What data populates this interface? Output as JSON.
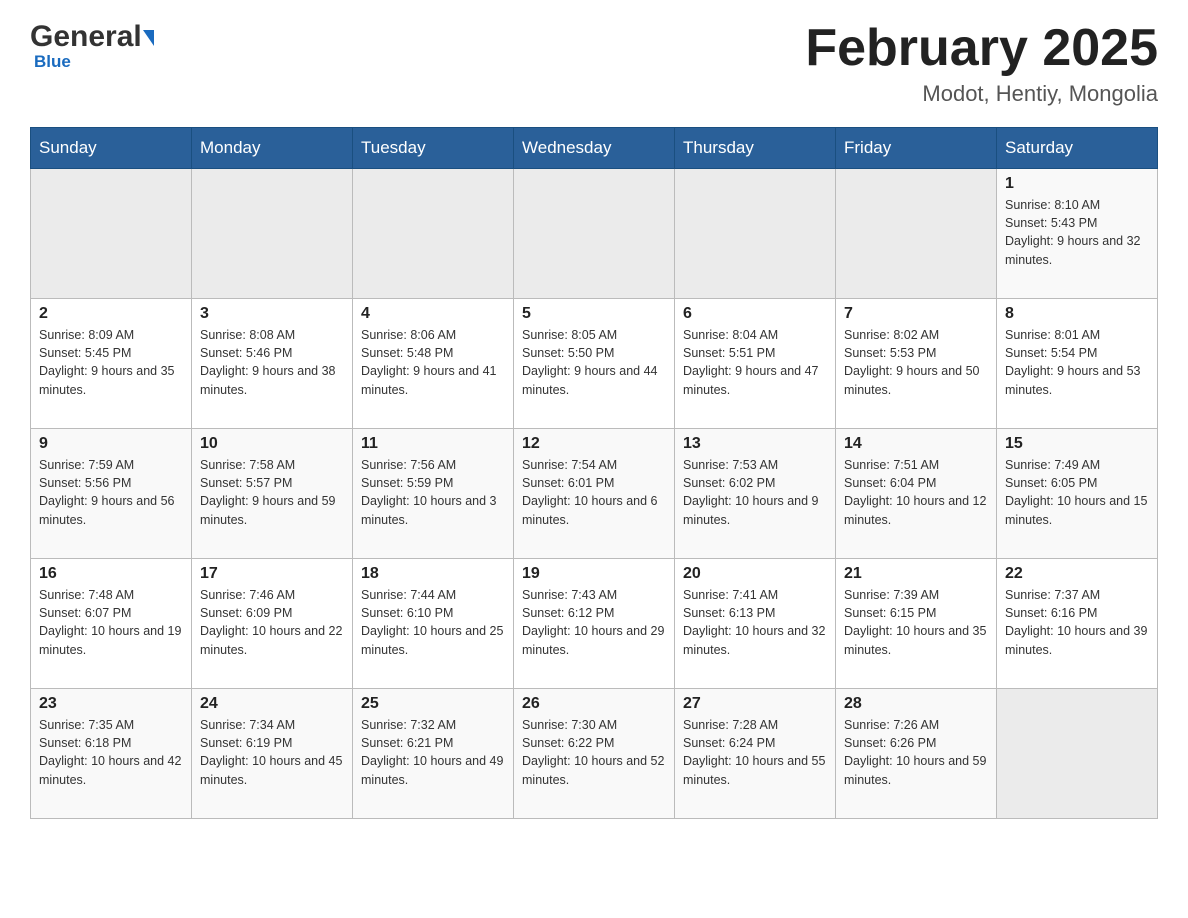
{
  "logo": {
    "brand": "General",
    "accent": "Blue",
    "color": "#1a6bbf"
  },
  "header": {
    "title": "February 2025",
    "subtitle": "Modot, Hentiy, Mongolia"
  },
  "weekdays": [
    "Sunday",
    "Monday",
    "Tuesday",
    "Wednesday",
    "Thursday",
    "Friday",
    "Saturday"
  ],
  "weeks": [
    [
      {
        "day": "",
        "info": ""
      },
      {
        "day": "",
        "info": ""
      },
      {
        "day": "",
        "info": ""
      },
      {
        "day": "",
        "info": ""
      },
      {
        "day": "",
        "info": ""
      },
      {
        "day": "",
        "info": ""
      },
      {
        "day": "1",
        "info": "Sunrise: 8:10 AM\nSunset: 5:43 PM\nDaylight: 9 hours and 32 minutes."
      }
    ],
    [
      {
        "day": "2",
        "info": "Sunrise: 8:09 AM\nSunset: 5:45 PM\nDaylight: 9 hours and 35 minutes."
      },
      {
        "day": "3",
        "info": "Sunrise: 8:08 AM\nSunset: 5:46 PM\nDaylight: 9 hours and 38 minutes."
      },
      {
        "day": "4",
        "info": "Sunrise: 8:06 AM\nSunset: 5:48 PM\nDaylight: 9 hours and 41 minutes."
      },
      {
        "day": "5",
        "info": "Sunrise: 8:05 AM\nSunset: 5:50 PM\nDaylight: 9 hours and 44 minutes."
      },
      {
        "day": "6",
        "info": "Sunrise: 8:04 AM\nSunset: 5:51 PM\nDaylight: 9 hours and 47 minutes."
      },
      {
        "day": "7",
        "info": "Sunrise: 8:02 AM\nSunset: 5:53 PM\nDaylight: 9 hours and 50 minutes."
      },
      {
        "day": "8",
        "info": "Sunrise: 8:01 AM\nSunset: 5:54 PM\nDaylight: 9 hours and 53 minutes."
      }
    ],
    [
      {
        "day": "9",
        "info": "Sunrise: 7:59 AM\nSunset: 5:56 PM\nDaylight: 9 hours and 56 minutes."
      },
      {
        "day": "10",
        "info": "Sunrise: 7:58 AM\nSunset: 5:57 PM\nDaylight: 9 hours and 59 minutes."
      },
      {
        "day": "11",
        "info": "Sunrise: 7:56 AM\nSunset: 5:59 PM\nDaylight: 10 hours and 3 minutes."
      },
      {
        "day": "12",
        "info": "Sunrise: 7:54 AM\nSunset: 6:01 PM\nDaylight: 10 hours and 6 minutes."
      },
      {
        "day": "13",
        "info": "Sunrise: 7:53 AM\nSunset: 6:02 PM\nDaylight: 10 hours and 9 minutes."
      },
      {
        "day": "14",
        "info": "Sunrise: 7:51 AM\nSunset: 6:04 PM\nDaylight: 10 hours and 12 minutes."
      },
      {
        "day": "15",
        "info": "Sunrise: 7:49 AM\nSunset: 6:05 PM\nDaylight: 10 hours and 15 minutes."
      }
    ],
    [
      {
        "day": "16",
        "info": "Sunrise: 7:48 AM\nSunset: 6:07 PM\nDaylight: 10 hours and 19 minutes."
      },
      {
        "day": "17",
        "info": "Sunrise: 7:46 AM\nSunset: 6:09 PM\nDaylight: 10 hours and 22 minutes."
      },
      {
        "day": "18",
        "info": "Sunrise: 7:44 AM\nSunset: 6:10 PM\nDaylight: 10 hours and 25 minutes."
      },
      {
        "day": "19",
        "info": "Sunrise: 7:43 AM\nSunset: 6:12 PM\nDaylight: 10 hours and 29 minutes."
      },
      {
        "day": "20",
        "info": "Sunrise: 7:41 AM\nSunset: 6:13 PM\nDaylight: 10 hours and 32 minutes."
      },
      {
        "day": "21",
        "info": "Sunrise: 7:39 AM\nSunset: 6:15 PM\nDaylight: 10 hours and 35 minutes."
      },
      {
        "day": "22",
        "info": "Sunrise: 7:37 AM\nSunset: 6:16 PM\nDaylight: 10 hours and 39 minutes."
      }
    ],
    [
      {
        "day": "23",
        "info": "Sunrise: 7:35 AM\nSunset: 6:18 PM\nDaylight: 10 hours and 42 minutes."
      },
      {
        "day": "24",
        "info": "Sunrise: 7:34 AM\nSunset: 6:19 PM\nDaylight: 10 hours and 45 minutes."
      },
      {
        "day": "25",
        "info": "Sunrise: 7:32 AM\nSunset: 6:21 PM\nDaylight: 10 hours and 49 minutes."
      },
      {
        "day": "26",
        "info": "Sunrise: 7:30 AM\nSunset: 6:22 PM\nDaylight: 10 hours and 52 minutes."
      },
      {
        "day": "27",
        "info": "Sunrise: 7:28 AM\nSunset: 6:24 PM\nDaylight: 10 hours and 55 minutes."
      },
      {
        "day": "28",
        "info": "Sunrise: 7:26 AM\nSunset: 6:26 PM\nDaylight: 10 hours and 59 minutes."
      },
      {
        "day": "",
        "info": ""
      }
    ]
  ]
}
